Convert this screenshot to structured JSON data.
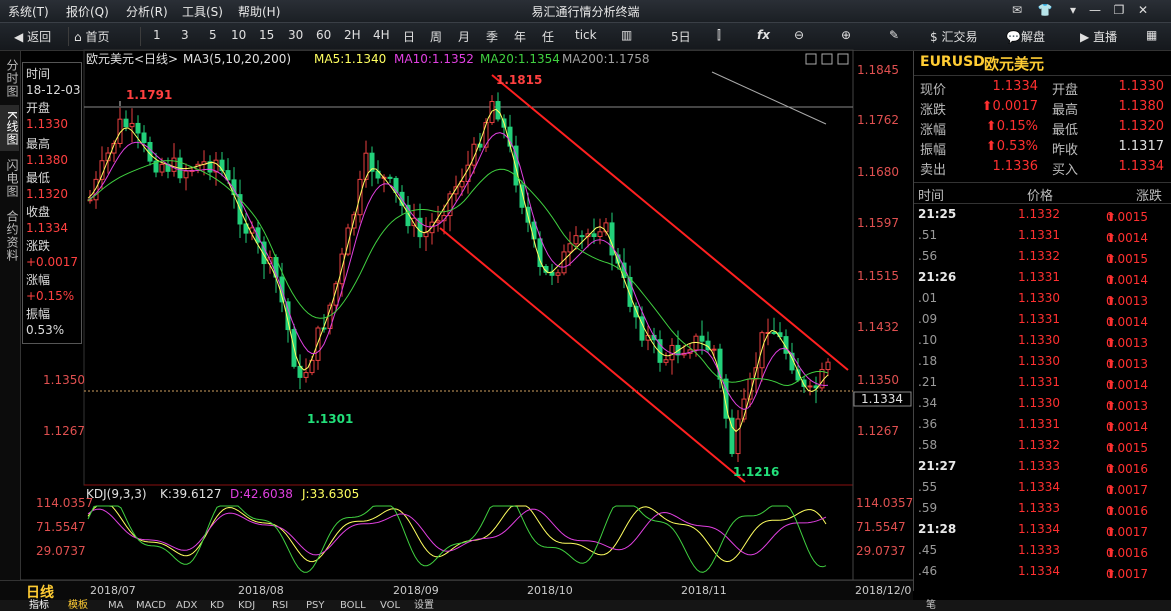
{
  "app": {
    "title": "易汇通行情分析终端"
  },
  "menu": [
    "系统(T)",
    "报价(Q)",
    "分析(R)",
    "工具(S)",
    "帮助(H)"
  ],
  "toolbar": {
    "back": "返回",
    "home": "首页",
    "periods": [
      "1",
      "3",
      "5",
      "10",
      "15",
      "30",
      "60",
      "2H",
      "4H",
      "日",
      "周",
      "月",
      "季",
      "年",
      "任",
      "tick"
    ],
    "five_day": "5日",
    "trade": "汇交易",
    "unlock": "解盘",
    "live": "直播"
  },
  "left_tabs": [
    "分时图",
    "K线图",
    "闪电图",
    "合约资料"
  ],
  "info_panel": {
    "time_label": "时间",
    "date": "18-12-03",
    "open_label": "开盘",
    "open": "1.1330",
    "high_label": "最高",
    "high": "1.1380",
    "low_label": "最低",
    "low": "1.1320",
    "close_label": "收盘",
    "close": "1.1334",
    "change_label": "涨跌",
    "change": "+0.0017",
    "pct_label": "涨幅",
    "pct": "+0.15%",
    "amp_label": "振幅",
    "amp": "0.53%"
  },
  "chart": {
    "symbol_label": "欧元美元<日线>",
    "ma_label": "MA3(5,10,20,200)",
    "ma5": "MA5:1.1340",
    "ma10": "MA10:1.1352",
    "ma20": "MA20:1.1354",
    "ma200": "MA200:1.1758",
    "kdj_label": "KDJ(9,3,3)",
    "kdj_k": "K:39.6127",
    "kdj_d": "D:42.6038",
    "kdj_j": "J:33.6305",
    "price_ticks": [
      "1.1845",
      "1.1762",
      "1.1680",
      "1.1597",
      "1.1515",
      "1.1432",
      "1.1350",
      "1.1267"
    ],
    "current_price": "1.1334",
    "left_ticks": [
      "1.1350",
      "1.1267"
    ],
    "kdj_ticks": [
      "114.0357",
      "71.5547",
      "29.0737"
    ],
    "annotations": {
      "p1": "1.1791",
      "p2": "1.1815",
      "p3": "1.1301",
      "p4": "1.1216"
    },
    "months": [
      "2018/07",
      "2018/08",
      "2018/09",
      "2018/10",
      "2018/11",
      "2018/12/0"
    ],
    "period_label": "日线",
    "colors": {
      "up": "#e84040",
      "down": "#22d07a",
      "ma5": "#ffff60",
      "ma10": "#e040e0",
      "ma20": "#40d040",
      "ma200": "#c0c0c0",
      "channel": "#ff2020"
    }
  },
  "quote": {
    "code": "EURUSD",
    "name": "欧元美元",
    "rows": [
      {
        "l1": "现价",
        "v1": "1.1334",
        "l2": "开盘",
        "v2": "1.1330"
      },
      {
        "l1": "涨跌",
        "v1": "0.0017",
        "l2": "最高",
        "v2": "1.1380"
      },
      {
        "l1": "涨幅",
        "v1": "0.15%",
        "l2": "最低",
        "v2": "1.1320"
      },
      {
        "l1": "振幅",
        "v1": "0.53%",
        "l2": "昨收",
        "v2": "1.1317"
      },
      {
        "l1": "卖出",
        "v1": "1.1336",
        "l2": "买入",
        "v2": "1.1334"
      }
    ],
    "header": {
      "time": "时间",
      "price": "价格",
      "change": "涨跌"
    },
    "ticks": [
      {
        "t": "21:25",
        "p": "1.1332",
        "c": "0.0015"
      },
      {
        "t": ".51",
        "p": "1.1331",
        "c": "0.0014"
      },
      {
        "t": ".56",
        "p": "1.1332",
        "c": "0.0015"
      },
      {
        "t": "21:26",
        "p": "1.1331",
        "c": "0.0014"
      },
      {
        "t": ".01",
        "p": "1.1330",
        "c": "0.0013"
      },
      {
        "t": ".09",
        "p": "1.1331",
        "c": "0.0014"
      },
      {
        "t": ".10",
        "p": "1.1330",
        "c": "0.0013"
      },
      {
        "t": ".18",
        "p": "1.1330",
        "c": "0.0013"
      },
      {
        "t": ".21",
        "p": "1.1331",
        "c": "0.0014"
      },
      {
        "t": ".34",
        "p": "1.1330",
        "c": "0.0013"
      },
      {
        "t": ".36",
        "p": "1.1331",
        "c": "0.0014"
      },
      {
        "t": ".58",
        "p": "1.1332",
        "c": "0.0015"
      },
      {
        "t": "21:27",
        "p": "1.1333",
        "c": "0.0016"
      },
      {
        "t": ".55",
        "p": "1.1334",
        "c": "0.0017"
      },
      {
        "t": ".59",
        "p": "1.1333",
        "c": "0.0016"
      },
      {
        "t": "21:28",
        "p": "1.1334",
        "c": "0.0017"
      },
      {
        "t": ".45",
        "p": "1.1333",
        "c": "0.0016"
      },
      {
        "t": ".46",
        "p": "1.1334",
        "c": "0.0017"
      }
    ]
  },
  "bottom_tabs": [
    "指标",
    "模板",
    "MA",
    "MACD",
    "ADX",
    "KD",
    "KDJ",
    "RSI",
    "PSY",
    "BOLL",
    "VOL",
    "设置"
  ],
  "bottom_right": "笔"
}
